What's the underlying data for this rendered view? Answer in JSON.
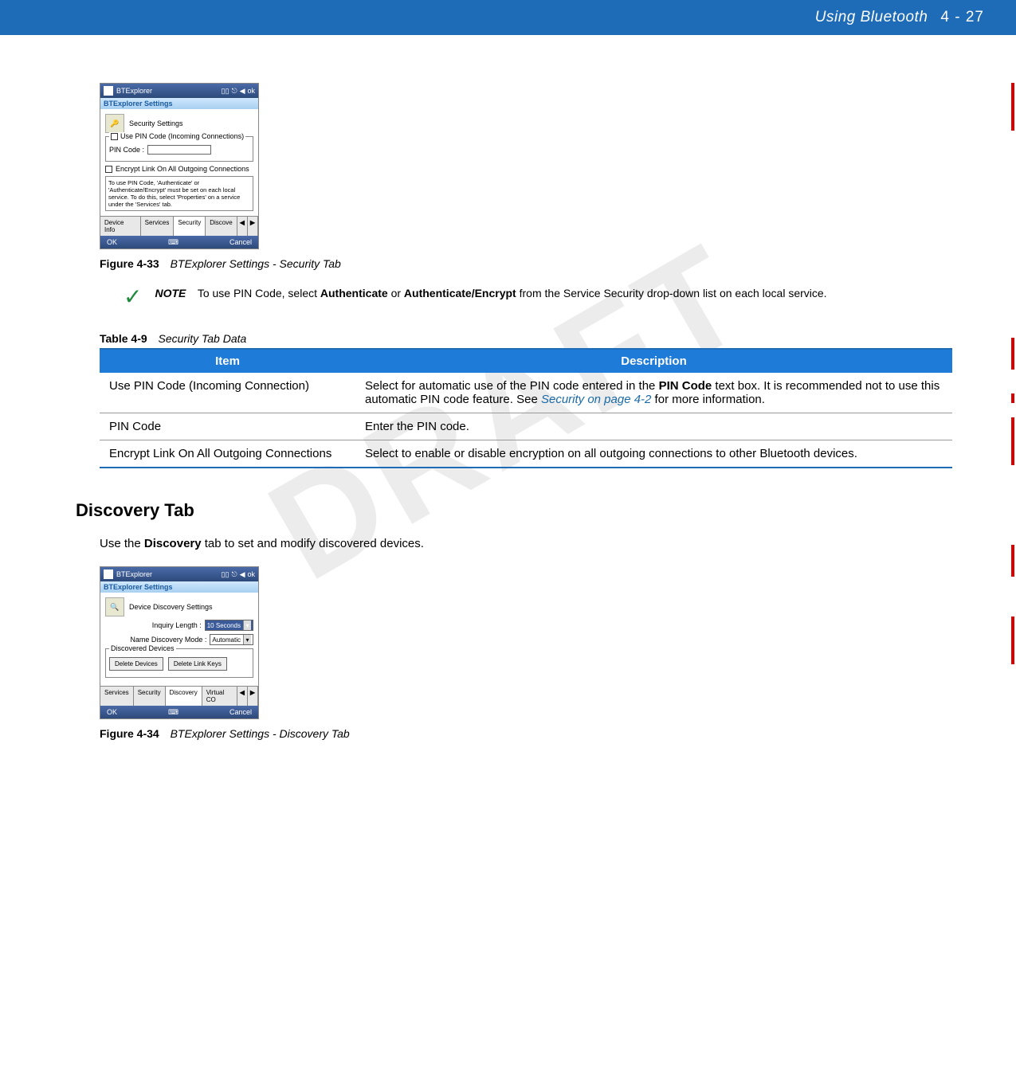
{
  "header": {
    "title": "Using Bluetooth",
    "page": "4 - 27"
  },
  "watermark": "DRAFT",
  "screenshot1": {
    "app_title": "BTExplorer",
    "ok": "ok",
    "subtitle": "BTExplorer Settings",
    "section": "Security Settings",
    "legend": "Use PIN Code (Incoming Connections)",
    "pin_label": "PIN Code :",
    "encrypt_label": "Encrypt Link On All Outgoing Connections",
    "info": "To use PIN Code, 'Authenticate' or 'Authenticate/Encrypt' must be set on each local service.  To do this, select 'Properties' on a service under the 'Services' tab.",
    "tabs": [
      "Device Info",
      "Services",
      "Security",
      "Discove"
    ],
    "bottom_ok": "OK",
    "bottom_cancel": "Cancel"
  },
  "figure1": {
    "label": "Figure 4-33",
    "title": "BTExplorer Settings - Security Tab"
  },
  "note": {
    "label": "NOTE",
    "text_pre": "To use PIN Code, select ",
    "bold1": "Authenticate",
    "mid": " or ",
    "bold2": "Authenticate/Encrypt",
    "text_post": " from the Service Security drop-down list on each local service."
  },
  "table": {
    "caption_label": "Table 4-9",
    "caption_title": "Security Tab Data",
    "head_item": "Item",
    "head_desc": "Description",
    "rows": [
      {
        "item": "Use PIN Code (Incoming Connection)",
        "desc_pre": "Select for automatic use of the PIN code entered in the ",
        "desc_bold": "PIN Code",
        "desc_mid": " text box. It is recommended not to use this automatic PIN code feature. See ",
        "desc_link": "Security on page 4-2",
        "desc_post": " for more information."
      },
      {
        "item": "PIN Code",
        "desc_pre": "Enter the PIN code.",
        "desc_bold": "",
        "desc_mid": "",
        "desc_link": "",
        "desc_post": ""
      },
      {
        "item": "Encrypt Link On All Outgoing Connections",
        "desc_pre": "Select to enable or disable encryption on all outgoing connections to other Bluetooth devices.",
        "desc_bold": "",
        "desc_mid": "",
        "desc_link": "",
        "desc_post": ""
      }
    ]
  },
  "section2": {
    "heading": "Discovery Tab",
    "intro_pre": "Use the ",
    "intro_bold": "Discovery",
    "intro_post": " tab to set and modify discovered devices."
  },
  "screenshot2": {
    "app_title": "BTExplorer",
    "ok": "ok",
    "subtitle": "BTExplorer Settings",
    "section": "Device Discovery Settings",
    "inquiry_label": "Inquiry Length :",
    "inquiry_value": "10 Seconds",
    "mode_label": "Name Discovery Mode :",
    "mode_value": "Automatic",
    "discovered_legend": "Discovered Devices",
    "btn_delete_devices": "Delete Devices",
    "btn_delete_keys": "Delete Link Keys",
    "tabs": [
      "Services",
      "Security",
      "Discovery",
      "Virtual CO"
    ],
    "bottom_ok": "OK",
    "bottom_cancel": "Cancel"
  },
  "figure2": {
    "label": "Figure 4-34",
    "title": "BTExplorer Settings - Discovery Tab"
  }
}
